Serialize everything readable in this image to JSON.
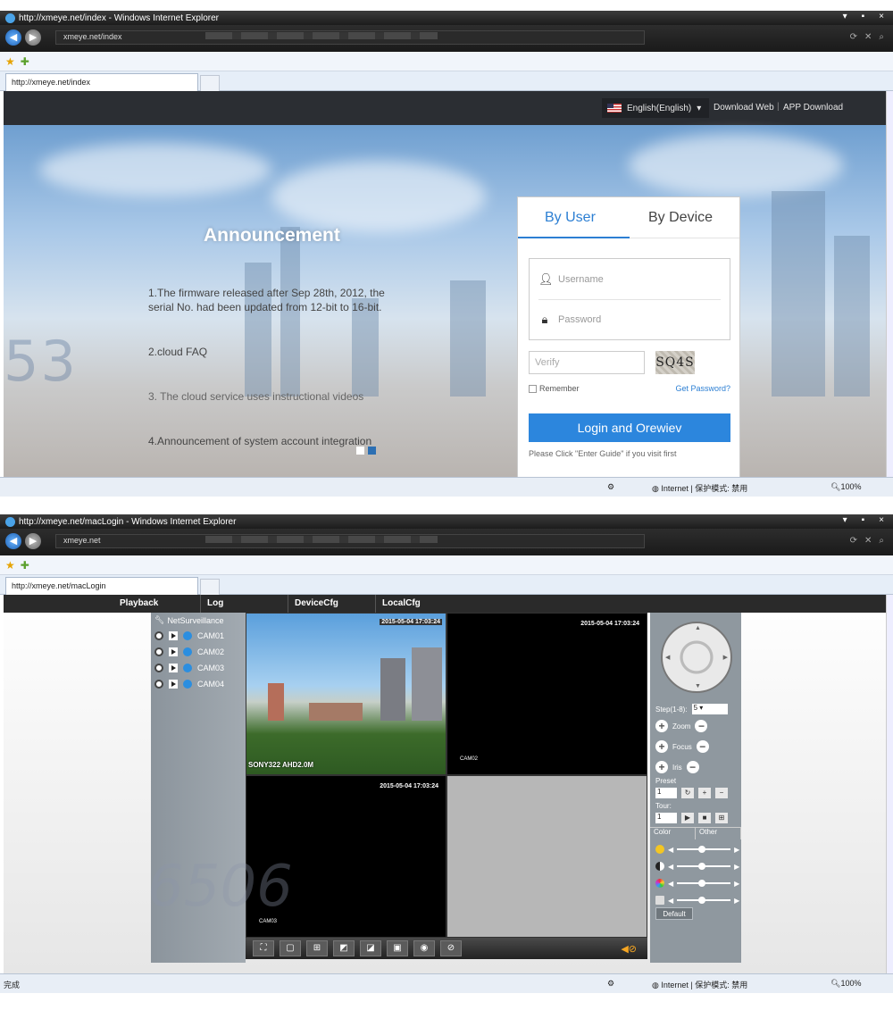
{
  "window1": {
    "title": "http://xmeye.net/index - Windows Internet Explorer",
    "address": "xmeye.net/index",
    "tab": "http://xmeye.net/index",
    "header": {
      "language": "English(English)",
      "download_web": "Download Web",
      "separator": "|",
      "app_download": "APP Download"
    },
    "hero": {
      "ghost_text": "53",
      "announcement_title": "Announcement",
      "items": [
        "1.The firmware released after Sep 28th, 2012, the serial No. had been updated from 12-bit to 16-bit.",
        "2.cloud FAQ",
        "3. The cloud service uses instructional videos",
        "4.Announcement of system account integration"
      ]
    },
    "login": {
      "tab_user": "By User",
      "tab_device": "By Device",
      "username_placeholder": "Username",
      "password_placeholder": "Password",
      "verify_placeholder": "Verify",
      "captcha": "SQ4S",
      "remember": "Remember",
      "get_password": "Get Password?",
      "login_button": "Login and Orewiev",
      "guide": "Please Click \"Enter Guide\" if you visit first"
    },
    "status": {
      "zone": "Internet | 保护模式: 禁用",
      "zoom": "100%"
    }
  },
  "window2": {
    "title": "http://xmeye.net/macLogin - Windows Internet Explorer",
    "address": "xmeye.net",
    "tab": "http://xmeye.net/macLogin",
    "menu": [
      "Playback",
      "Log",
      "DeviceCfg",
      "LocalCfg"
    ],
    "tree": {
      "root": "NetSurveillance",
      "cameras": [
        "CAM01",
        "CAM02",
        "CAM03",
        "CAM04"
      ]
    },
    "video": {
      "cell1_timestamp": "2015-05-04 17:03:24",
      "cell1_label": "SONY322 AHD2.0M",
      "cell2_timestamp": "2015-05-04 17:03:24",
      "cell2_label": "CAM02",
      "cell3_timestamp": "2015-05-04 17:03:24",
      "cell3_label": "CAM03",
      "ghost_text": "6506"
    },
    "ptz": {
      "step_label": "Step(1-8):",
      "step_value": "5",
      "zoom": "Zoom",
      "focus": "Focus",
      "iris": "Iris",
      "preset_label": "Preset",
      "preset_value": "1",
      "tour_label": "Tour:",
      "tour_value": "1",
      "color_tab": "Color",
      "other_tab": "Other",
      "default_button": "Default"
    },
    "status": {
      "left": "完成",
      "zone": "Internet | 保护模式: 禁用",
      "zoom": "100%"
    }
  }
}
